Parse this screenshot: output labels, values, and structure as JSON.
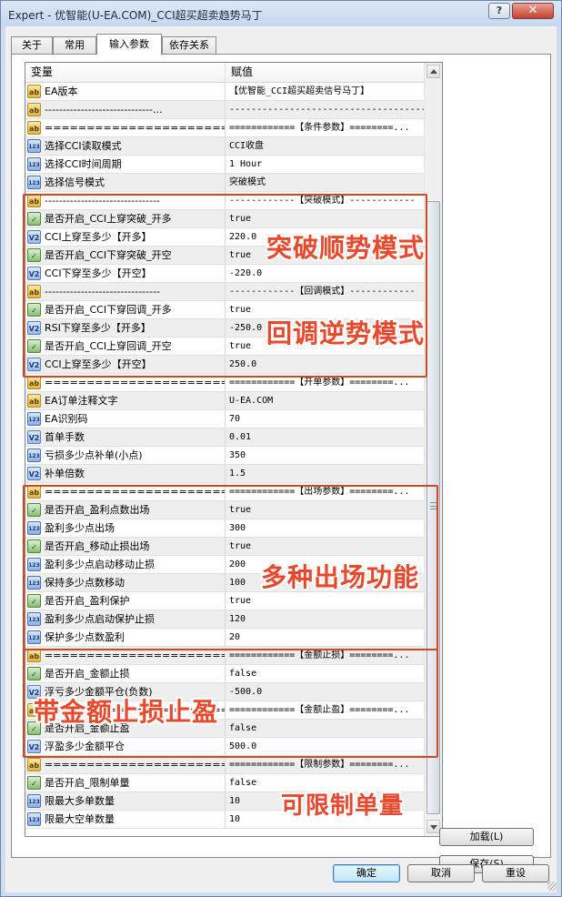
{
  "window": {
    "title": "Expert - 优智能(U-EA.COM)_CCI超买超卖趋势马丁",
    "help_label": "?",
    "close_label": "✕"
  },
  "tabs": [
    {
      "label": "关于"
    },
    {
      "label": "常用"
    },
    {
      "label": "输入参数"
    },
    {
      "label": "依存关系"
    }
  ],
  "grid": {
    "header_variable": "变量",
    "header_value": "赋值",
    "rows": [
      {
        "icon": "ab",
        "name": "EA版本",
        "value": "【优智能_CCI超买超卖信号马丁】"
      },
      {
        "icon": "ab",
        "name": "------------------------------...",
        "value": "------------------------------------..."
      },
      {
        "icon": "ab",
        "name": "==============================",
        "value": "============【条件参数】========..."
      },
      {
        "icon": "123",
        "name": "选择CCI读取模式",
        "value": "CCI收盘"
      },
      {
        "icon": "123",
        "name": "选择CCI时间周期",
        "value": "1 Hour"
      },
      {
        "icon": "123",
        "name": "选择信号模式",
        "value": "突破模式"
      },
      {
        "icon": "ab",
        "name": "--------------------------------",
        "value": "------------【突破模式】------------"
      },
      {
        "icon": "f",
        "name": "是否开启_CCI上穿突破_开多",
        "value": "true"
      },
      {
        "icon": "v",
        "name": "CCI上穿至多少【开多】",
        "value": "220.0"
      },
      {
        "icon": "f",
        "name": "是否开启_CCI下穿突破_开空",
        "value": "true"
      },
      {
        "icon": "v",
        "name": "CCI下穿至多少【开空】",
        "value": "-220.0"
      },
      {
        "icon": "ab",
        "name": "--------------------------------",
        "value": "------------【回调模式】------------"
      },
      {
        "icon": "f",
        "name": "是否开启_CCI下穿回调_开多",
        "value": "true"
      },
      {
        "icon": "v",
        "name": "RSI下穿至多少【开多】",
        "value": "-250.0"
      },
      {
        "icon": "f",
        "name": "是否开启_CCI上穿回调_开空",
        "value": "true"
      },
      {
        "icon": "v",
        "name": "CCI上穿至多少【开空】",
        "value": "250.0"
      },
      {
        "icon": "ab",
        "name": "==============================",
        "value": "============【开单参数】========..."
      },
      {
        "icon": "ab",
        "name": "EA订单注释文字",
        "value": "U-EA.COM"
      },
      {
        "icon": "123",
        "name": "EA识别码",
        "value": "70"
      },
      {
        "icon": "v",
        "name": "首单手数",
        "value": "0.01"
      },
      {
        "icon": "123",
        "name": "亏损多少点补单(小点)",
        "value": "350"
      },
      {
        "icon": "v",
        "name": "补单倍数",
        "value": "1.5"
      },
      {
        "icon": "ab",
        "name": "==============================",
        "value": "============【出场参数】========..."
      },
      {
        "icon": "f",
        "name": "是否开启_盈利点数出场",
        "value": "true"
      },
      {
        "icon": "123",
        "name": "盈利多少点出场",
        "value": "300"
      },
      {
        "icon": "f",
        "name": "是否开启_移动止损出场",
        "value": "true"
      },
      {
        "icon": "123",
        "name": "盈利多少点启动移动止损",
        "value": "200"
      },
      {
        "icon": "123",
        "name": "保持多少点数移动",
        "value": "100"
      },
      {
        "icon": "f",
        "name": "是否开启_盈利保护",
        "value": "true"
      },
      {
        "icon": "123",
        "name": "盈利多少点启动保护止损",
        "value": "120"
      },
      {
        "icon": "123",
        "name": "保护多少点数盈利",
        "value": "20"
      },
      {
        "icon": "ab",
        "name": "==============================",
        "value": "============【金额止损】========..."
      },
      {
        "icon": "f",
        "name": "是否开启_金额止损",
        "value": "false"
      },
      {
        "icon": "v",
        "name": "浮亏多少金额平仓(负数)",
        "value": "-500.0"
      },
      {
        "icon": "ab",
        "name": "==============================",
        "value": "============【金额止盈】========..."
      },
      {
        "icon": "f",
        "name": "是否开启_金额止盈",
        "value": "false"
      },
      {
        "icon": "v",
        "name": "浮盈多少金额平仓",
        "value": "500.0"
      },
      {
        "icon": "ab",
        "name": "==============================",
        "value": "============【限制参数】========..."
      },
      {
        "icon": "f",
        "name": "是否开启_限制单量",
        "value": "false"
      },
      {
        "icon": "123",
        "name": "限最大多单数量",
        "value": "10"
      },
      {
        "icon": "123",
        "name": "限最大空单数量",
        "value": "10"
      }
    ]
  },
  "side_buttons": {
    "load": "加载(L)",
    "save": "保存(S)"
  },
  "footer_buttons": {
    "ok": "确定",
    "cancel": "取消",
    "reset": "重设"
  },
  "annotations": {
    "breakout": "突破顺势模式",
    "pullback": "回调逆势模式",
    "exits": "多种出场功能",
    "money": "带金额止损止盈",
    "limit": "可限制单量"
  },
  "colors": {
    "annotation_red": "#e8482c",
    "box_red": "#d6471f"
  }
}
